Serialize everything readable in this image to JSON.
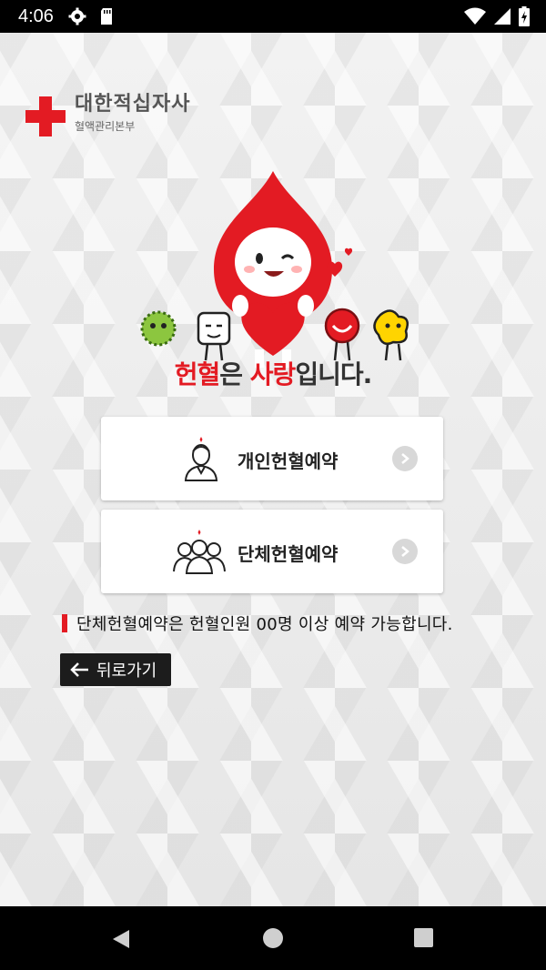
{
  "status_bar": {
    "time": "4:06",
    "icons_left": [
      "gear-icon",
      "sd-card-icon"
    ],
    "icons_right": [
      "wifi-icon",
      "signal-icon",
      "battery-charging-icon"
    ]
  },
  "logo": {
    "title": "대한적십자사",
    "subtitle": "혈액관리본부",
    "cross_color": "#e31b23"
  },
  "slogan": {
    "part1": "헌혈",
    "part2": "은 ",
    "part3": "사랑",
    "part4": "입니다."
  },
  "menu": {
    "personal_label": "개인헌혈예약",
    "group_label": "단체헌혈예약"
  },
  "notice": {
    "text": "단체헌혈예약은 헌혈인원 00명 이상 예약 가능합니다."
  },
  "back_button": {
    "label": "뒤로가기"
  },
  "colors": {
    "accent": "#e31b23",
    "dark_button": "#1c1c1c"
  }
}
